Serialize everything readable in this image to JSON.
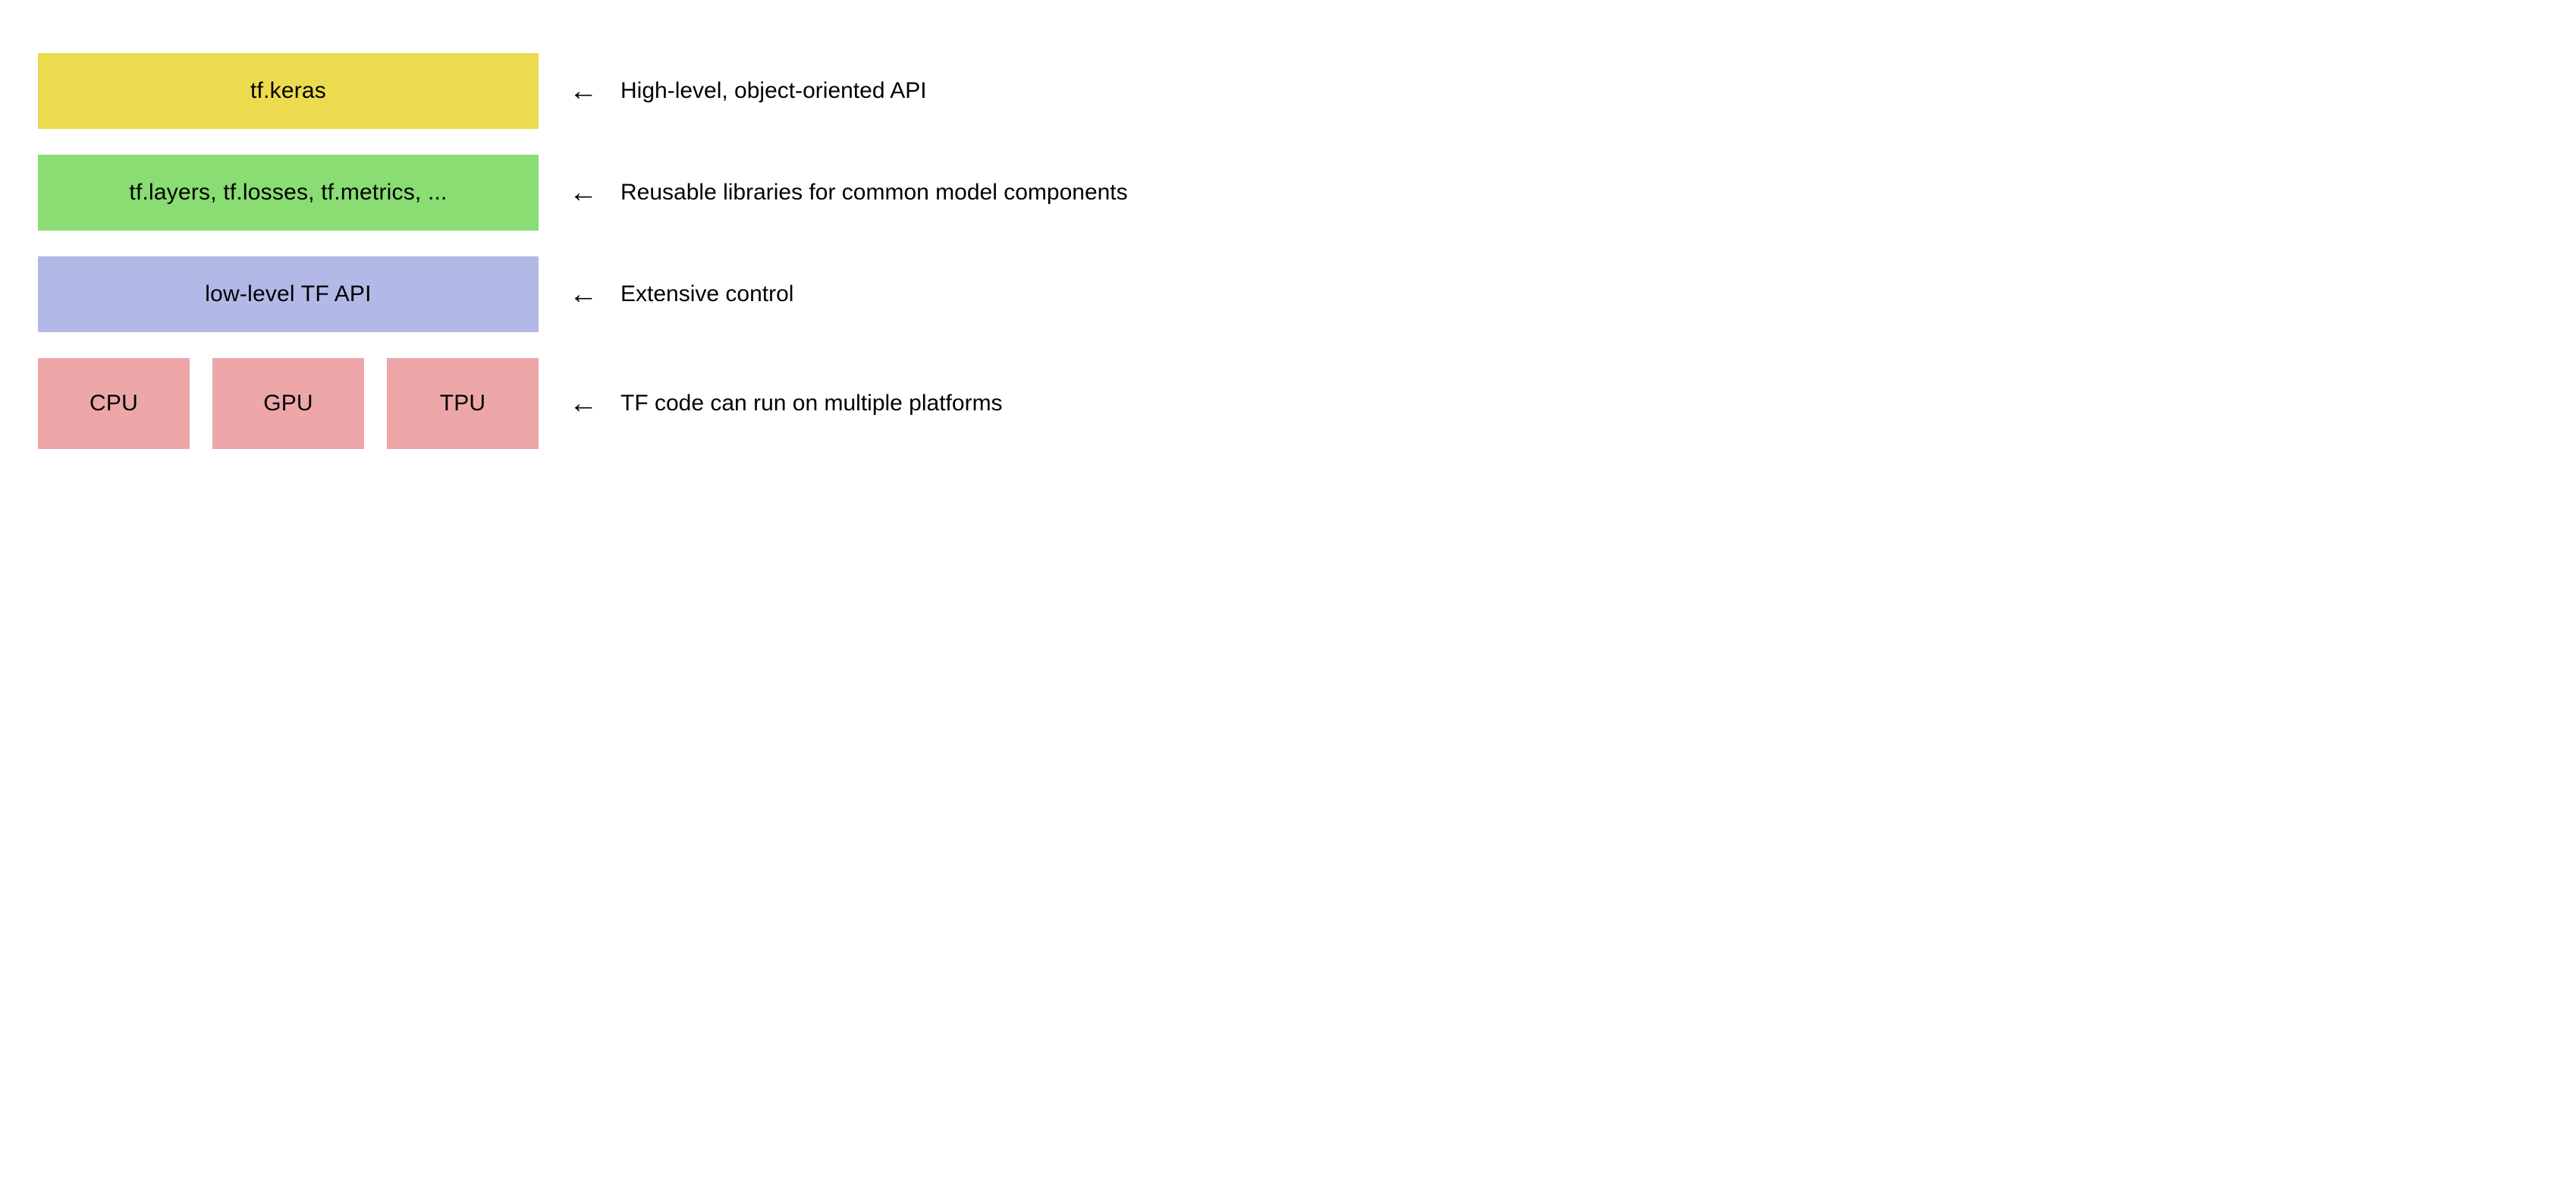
{
  "layers": [
    {
      "blocks": [
        "tf.keras"
      ],
      "color": "yellow",
      "description": "High-level, object-oriented API"
    },
    {
      "blocks": [
        "tf.layers, tf.losses, tf.metrics, ..."
      ],
      "color": "green",
      "description": "Reusable libraries for common model components"
    },
    {
      "blocks": [
        "low-level TF API"
      ],
      "color": "blue",
      "description": "Extensive control"
    },
    {
      "blocks": [
        "CPU",
        "GPU",
        "TPU"
      ],
      "color": "pink",
      "description": "TF code can run on multiple platforms"
    }
  ],
  "arrow_glyph": "←"
}
